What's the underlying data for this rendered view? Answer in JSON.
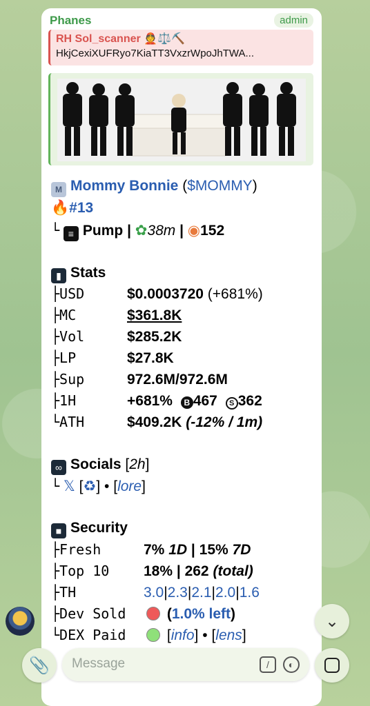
{
  "message": {
    "sender": "Phanes",
    "role": "admin",
    "reply": {
      "name": "RH Sol_scanner 👲⚖️⛏️",
      "text": "HkjCexiXUFRyo7KiaTT3VxzrWpoJhTWA..."
    }
  },
  "token": {
    "name": "Mommy Bonnie",
    "symbol_open": "(",
    "symbol": "$MOMMY",
    "symbol_close": ")",
    "rank": "#13"
  },
  "tree": {
    "mid": "├",
    "last": "└"
  },
  "platform": {
    "name": "Pump",
    "sep": " | ",
    "age": "38m",
    "views": "152"
  },
  "stats": {
    "heading": "Stats",
    "rows": [
      {
        "label": "├USD",
        "value": "$0.0003720",
        "extra": "(+681%)"
      },
      {
        "label": "├MC",
        "value": "$361.8K"
      },
      {
        "label": "├Vol",
        "value": "$285.2K"
      },
      {
        "label": "├LP",
        "value": "$27.8K"
      },
      {
        "label": "├Sup",
        "value": "972.6M/972.6M"
      },
      {
        "label": "├1H",
        "value": "+681%",
        "buys": "467",
        "sells": "362"
      },
      {
        "label": "└ATH",
        "value": "$409.2K",
        "extra": "(-12% / 1m)"
      }
    ]
  },
  "socials": {
    "heading": "Socials",
    "age_open": "[",
    "age": "2h",
    "age_close": "]",
    "bracket_open": "[",
    "bracket_close": "]",
    "dot": "•",
    "lore": "lore"
  },
  "security": {
    "heading": "Security",
    "rows": [
      {
        "label": "├Fresh",
        "v1": "7%",
        "p1": "1D",
        "sep": "|",
        "v2": "15%",
        "p2": "7D"
      },
      {
        "label": "├Top 10",
        "value": "18% | 262",
        "extra": "(total)"
      },
      {
        "label": "├TH",
        "v0": "3.0",
        "v1": "2.3",
        "v2": "2.1",
        "v3": "2.0",
        "v4": "1.6"
      },
      {
        "label": "├Dev Sold",
        "open": "(",
        "value": "1.0% left",
        "rest": ")"
      },
      {
        "label": "└DEX Paid",
        "info": "info",
        "lens": "lens"
      }
    ]
  },
  "composer": {
    "placeholder": "Message"
  },
  "colors": {
    "sender": "#3e9a4a",
    "reply_accent": "#d9534f",
    "link": "#2a5db0",
    "media_accent": "#62b45a"
  }
}
